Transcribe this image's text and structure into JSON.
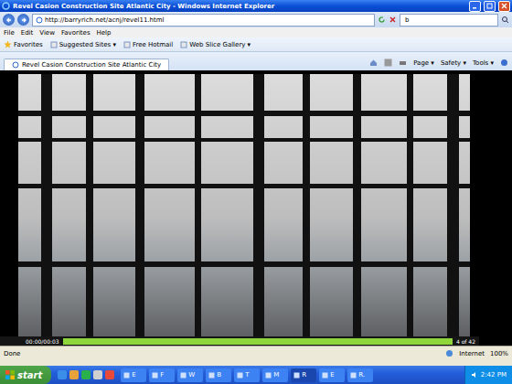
{
  "window": {
    "title": "Revel Casion Construction Site Atlantic City - Windows Internet Explorer"
  },
  "address_bar": {
    "url": "http://barryrich.net/acnj/revel11.html",
    "search": "b"
  },
  "menu": [
    "File",
    "Edit",
    "View",
    "Favorites",
    "Help"
  ],
  "favorites_bar": {
    "label": "Favorites",
    "items": [
      "Suggested Sites ▾",
      "Free Hotmail",
      "Web Slice Gallery ▾"
    ]
  },
  "tabs": [
    {
      "label": "Revel Casion Construction Site Atlantic City",
      "selected": true
    }
  ],
  "command_bar": [
    "Page ▾",
    "Safety ▾",
    "Tools ▾"
  ],
  "slideshow": {
    "time": "00:00/00:03",
    "level": 1,
    "counter": "4 of 42"
  },
  "status_bar": {
    "text": "Done",
    "zone": "Internet",
    "zoom": "100%"
  },
  "taskbar": {
    "start": "start",
    "tasks": [
      {
        "label": "E",
        "selected": false
      },
      {
        "label": "F",
        "selected": false
      },
      {
        "label": "W",
        "selected": false
      },
      {
        "label": "B",
        "selected": false
      },
      {
        "label": "T",
        "selected": false
      },
      {
        "label": "M",
        "selected": false
      },
      {
        "label": "R",
        "selected": true
      },
      {
        "label": "E",
        "selected": false
      },
      {
        "label": "R.",
        "selected": false
      }
    ],
    "clock": "2:42 PM"
  }
}
